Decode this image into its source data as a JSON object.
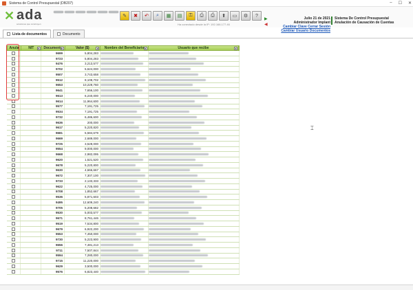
{
  "window": {
    "title": "Sistema de Control Presupuestal (DB207)",
    "buttons": [
      "–",
      "☐",
      "✕"
    ]
  },
  "brand": {
    "logo": "ada",
    "tagline": "soluciones que construyen"
  },
  "toolbar": {
    "buttons": [
      {
        "name": "blurred-btn-1",
        "glyph": ""
      },
      {
        "name": "blurred-btn-2",
        "glyph": ""
      },
      {
        "name": "blurred-btn-3",
        "glyph": ""
      },
      {
        "name": "blurred-btn-4",
        "glyph": ""
      },
      {
        "name": "blurred-btn-5",
        "glyph": ""
      },
      {
        "name": "blurred-btn-6",
        "glyph": ""
      },
      {
        "name": "edit-icon",
        "glyph": "✎"
      },
      {
        "name": "delete-icon",
        "glyph": "✖"
      },
      {
        "name": "undo-icon",
        "glyph": "↶"
      },
      {
        "name": "search-icon",
        "glyph": "⌕"
      },
      {
        "name": "sheet-icon",
        "glyph": "▦"
      },
      {
        "name": "chart-icon",
        "glyph": "▤"
      },
      {
        "name": "lock-icon",
        "glyph": "⚿"
      },
      {
        "name": "print-icon",
        "glyph": "⎙"
      },
      {
        "name": "print-preview-icon",
        "glyph": "⎙"
      },
      {
        "name": "export-icon",
        "glyph": "⬆"
      },
      {
        "name": "folder-icon",
        "glyph": "▭"
      },
      {
        "name": "settings-icon",
        "glyph": "⚙"
      },
      {
        "name": "help-icon",
        "glyph": "?"
      }
    ]
  },
  "connection": "Ha conectado desde la IP: 192.168.177.46",
  "user": {
    "date": "Julio 21 de 2021",
    "name": "Administrador Implant",
    "change_password": "Cambiar Clave",
    "close_session": "Cerrar Sesión",
    "change_user": "Cambiar Usuario Documentos"
  },
  "system": {
    "line1": "Sistema De Control Presupuestal",
    "line2": "Anulación de Causación de Cuentas"
  },
  "tabs": [
    {
      "label": "Lista de documentos",
      "active": true
    },
    {
      "label": "Documento",
      "active": false
    }
  ],
  "grid": {
    "columns": [
      "Anula",
      "NIT",
      "Documento",
      "Valor ($)",
      "Nombre del Beneficiario",
      "Usuario que recibe"
    ],
    "rows": [
      [
        "9699",
        "5,804,283"
      ],
      [
        "9723",
        "5,804,283"
      ],
      [
        "9476",
        "3,213,577"
      ],
      [
        "9702",
        "5,624,000"
      ],
      [
        "9507",
        "3,743,658"
      ],
      [
        "9512",
        "8,108,702"
      ],
      [
        "9653",
        "10,229,760"
      ],
      [
        "9641",
        "7,656,100"
      ],
      [
        "9613",
        "6,240,000"
      ],
      [
        "9614",
        "11,964,600"
      ],
      [
        "9577",
        "7,191,725"
      ],
      [
        "9534",
        "7,191,725"
      ],
      [
        "9732",
        "6,486,600"
      ],
      [
        "9636",
        "200,000"
      ],
      [
        "9617",
        "5,220,820"
      ],
      [
        "9681",
        "5,584,679"
      ],
      [
        "9669",
        "2,689,000"
      ],
      [
        "9725",
        "3,528,000"
      ],
      [
        "9554",
        "9,000,000"
      ],
      [
        "9668",
        "2,982,095"
      ],
      [
        "9620",
        "1,521,520"
      ],
      [
        "9678",
        "5,220,800"
      ],
      [
        "9630",
        "4,666,667"
      ],
      [
        "9672",
        "7,307,100"
      ],
      [
        "9733",
        "2,133,333"
      ],
      [
        "9622",
        "4,725,000"
      ],
      [
        "9708",
        "1,852,667"
      ],
      [
        "9536",
        "5,871,603"
      ],
      [
        "9495",
        "12,609,240"
      ],
      [
        "9705",
        "5,208,682"
      ],
      [
        "9530",
        "5,003,577"
      ],
      [
        "9671",
        "8,761,446"
      ],
      [
        "9519",
        "7,534,800"
      ],
      [
        "9679",
        "6,922,200"
      ],
      [
        "9553",
        "7,450,000"
      ],
      [
        "9730",
        "5,223,900"
      ],
      [
        "9656",
        "7,481,213"
      ],
      [
        "9711",
        "7,507,844"
      ],
      [
        "9594",
        "7,280,000"
      ],
      [
        "9715",
        "11,220,000"
      ],
      [
        "9629",
        "3,500,000"
      ],
      [
        "9576",
        "6,823,440"
      ]
    ]
  }
}
